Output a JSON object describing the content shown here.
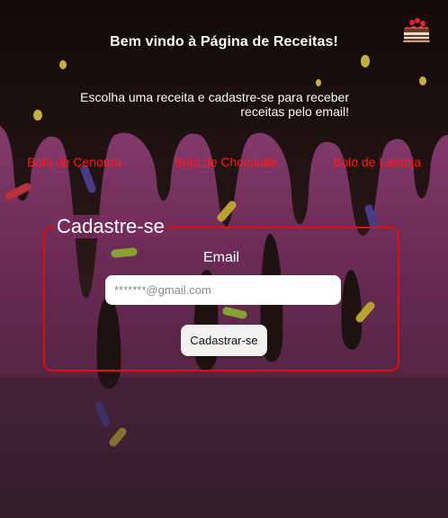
{
  "header": {
    "title": "Bem vindo à Página de Receitas!",
    "subtitle": "Escolha uma receita e cadastre-se para receber receitas pelo email!"
  },
  "nav": {
    "links": [
      {
        "label": "Bolo de Cenoura"
      },
      {
        "label": "Bolo de Chocolate"
      },
      {
        "label": "Bolo de Laranja"
      }
    ]
  },
  "signup": {
    "legend": "Cadastre-se",
    "email_label": "Email",
    "email_placeholder": "*******@gmail.com",
    "email_value": "",
    "submit_label": "Cadastrar-se"
  },
  "icons": {
    "top_right": "cake-icon"
  },
  "colors": {
    "link": "#ff1a1a",
    "fieldset_border": "#e00d0d",
    "frosting": "#8a3a72",
    "chocolate": "#241414",
    "text": "#ffffff"
  }
}
